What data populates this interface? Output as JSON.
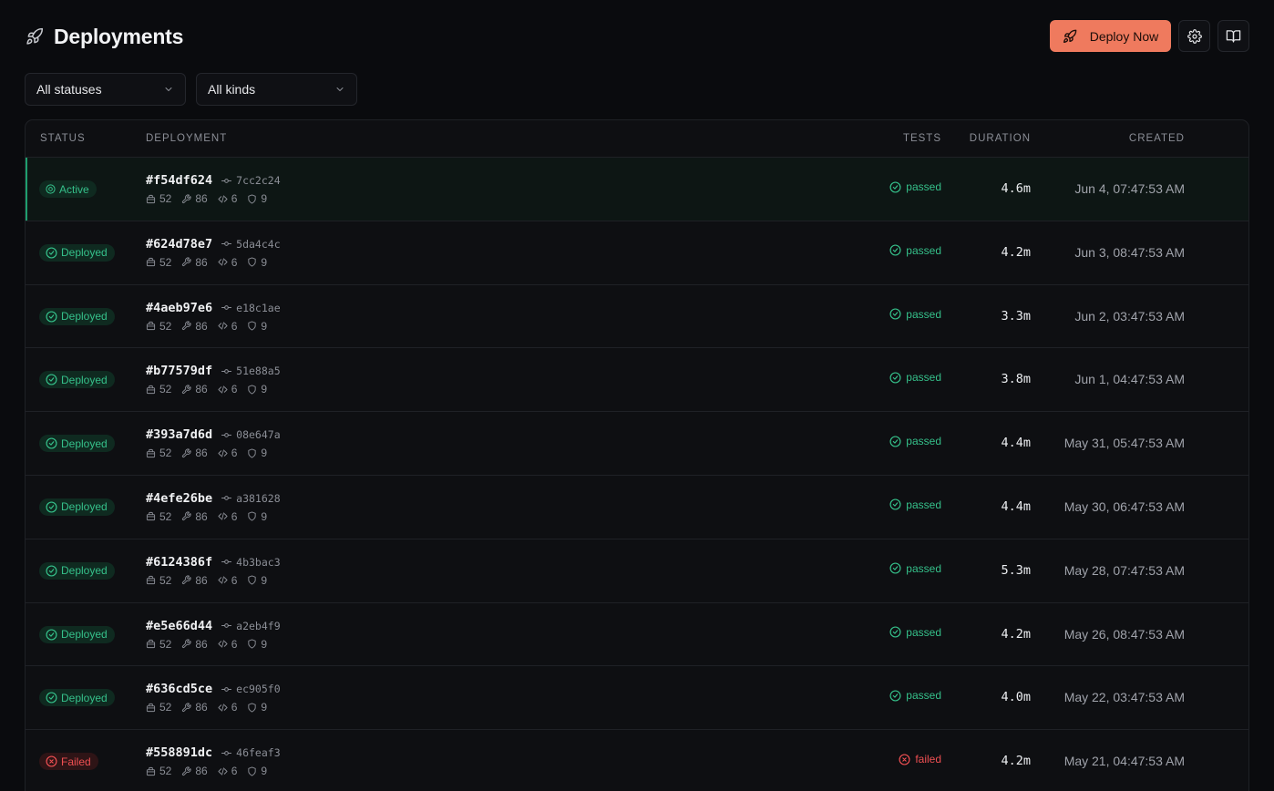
{
  "header": {
    "title": "Deployments",
    "deploy_label": "Deploy Now"
  },
  "filters": {
    "status": "All statuses",
    "kind": "All kinds"
  },
  "columns": {
    "status": "STATUS",
    "deployment": "DEPLOYMENT",
    "tests": "TESTS",
    "duration": "DURATION",
    "created": "CREATED"
  },
  "colors": {
    "accent": "#ef7a5e",
    "success": "#35c08a",
    "danger": "#ef4f52"
  },
  "rows": [
    {
      "status": "Active",
      "kind": "active",
      "id": "#f54df624",
      "commit": "7cc2c24",
      "stats": [
        "52",
        "86",
        "6",
        "9"
      ],
      "tests": "passed",
      "duration": "4.6m",
      "created": "Jun 4, 07:47:53 AM"
    },
    {
      "status": "Deployed",
      "kind": "deployed",
      "id": "#624d78e7",
      "commit": "5da4c4c",
      "stats": [
        "52",
        "86",
        "6",
        "9"
      ],
      "tests": "passed",
      "duration": "4.2m",
      "created": "Jun 3, 08:47:53 AM"
    },
    {
      "status": "Deployed",
      "kind": "deployed",
      "id": "#4aeb97e6",
      "commit": "e18c1ae",
      "stats": [
        "52",
        "86",
        "6",
        "9"
      ],
      "tests": "passed",
      "duration": "3.3m",
      "created": "Jun 2, 03:47:53 AM"
    },
    {
      "status": "Deployed",
      "kind": "deployed",
      "id": "#b77579df",
      "commit": "51e88a5",
      "stats": [
        "52",
        "86",
        "6",
        "9"
      ],
      "tests": "passed",
      "duration": "3.8m",
      "created": "Jun 1, 04:47:53 AM"
    },
    {
      "status": "Deployed",
      "kind": "deployed",
      "id": "#393a7d6d",
      "commit": "08e647a",
      "stats": [
        "52",
        "86",
        "6",
        "9"
      ],
      "tests": "passed",
      "duration": "4.4m",
      "created": "May 31, 05:47:53 AM"
    },
    {
      "status": "Deployed",
      "kind": "deployed",
      "id": "#4efe26be",
      "commit": "a381628",
      "stats": [
        "52",
        "86",
        "6",
        "9"
      ],
      "tests": "passed",
      "duration": "4.4m",
      "created": "May 30, 06:47:53 AM"
    },
    {
      "status": "Deployed",
      "kind": "deployed",
      "id": "#6124386f",
      "commit": "4b3bac3",
      "stats": [
        "52",
        "86",
        "6",
        "9"
      ],
      "tests": "passed",
      "duration": "5.3m",
      "created": "May 28, 07:47:53 AM"
    },
    {
      "status": "Deployed",
      "kind": "deployed",
      "id": "#e5e66d44",
      "commit": "a2eb4f9",
      "stats": [
        "52",
        "86",
        "6",
        "9"
      ],
      "tests": "passed",
      "duration": "4.2m",
      "created": "May 26, 08:47:53 AM"
    },
    {
      "status": "Deployed",
      "kind": "deployed",
      "id": "#636cd5ce",
      "commit": "ec905f0",
      "stats": [
        "52",
        "86",
        "6",
        "9"
      ],
      "tests": "passed",
      "duration": "4.0m",
      "created": "May 22, 03:47:53 AM"
    },
    {
      "status": "Failed",
      "kind": "failed",
      "id": "#558891dc",
      "commit": "46feaf3",
      "stats": [
        "52",
        "86",
        "6",
        "9"
      ],
      "tests": "failed",
      "duration": "4.2m",
      "created": "May 21, 04:47:53 AM"
    }
  ],
  "icons": {
    "brand": "rocket-icon",
    "settings": "gear-icon",
    "docs": "book-open-icon",
    "filter": "chevron-down-icon",
    "commit": "git-commit-icon",
    "stats": [
      "package-icon",
      "wrench-icon",
      "code-icon",
      "shield-icon"
    ],
    "passed": "check-circle-icon",
    "failed": "x-circle-icon"
  }
}
